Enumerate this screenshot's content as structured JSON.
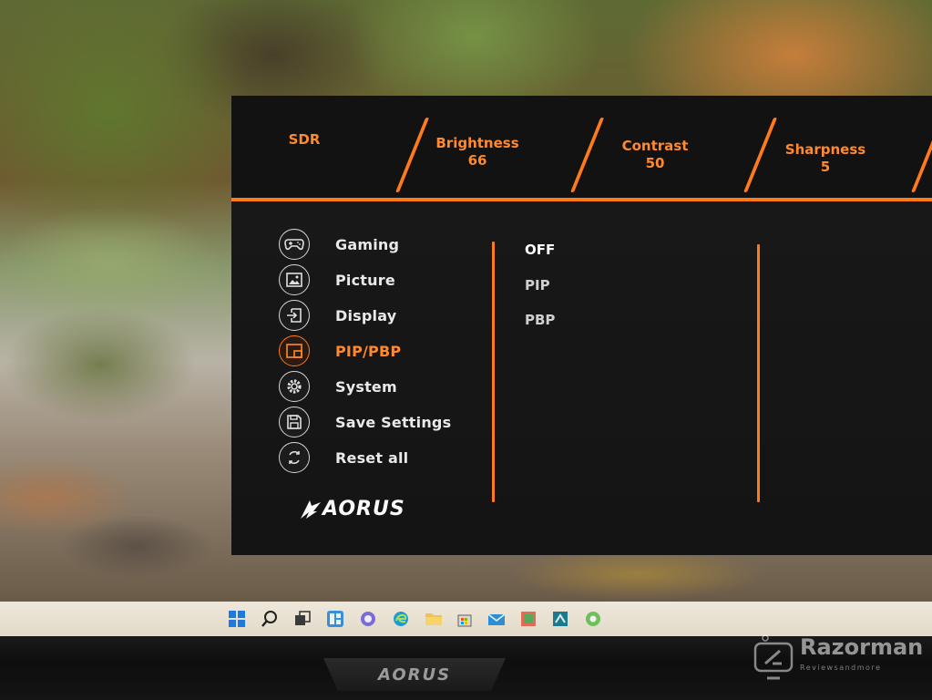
{
  "osd": {
    "top_bar": [
      {
        "label": "SDR",
        "value": ""
      },
      {
        "label": "Brightness",
        "value": "66"
      },
      {
        "label": "Contrast",
        "value": "50"
      },
      {
        "label": "Sharpness",
        "value": "5"
      }
    ],
    "menu": [
      {
        "label": "Gaming",
        "icon": "gamepad-icon",
        "active": false
      },
      {
        "label": "Picture",
        "icon": "picture-icon",
        "active": false
      },
      {
        "label": "Display",
        "icon": "input-icon",
        "active": false
      },
      {
        "label": "PIP/PBP",
        "icon": "pip-icon",
        "active": true
      },
      {
        "label": "System",
        "icon": "gear-icon",
        "active": false
      },
      {
        "label": "Save Settings",
        "icon": "floppy-disk-icon",
        "active": false
      },
      {
        "label": "Reset all",
        "icon": "reset-icon",
        "active": false
      }
    ],
    "options": [
      {
        "label": "OFF",
        "selected": true
      },
      {
        "label": "PIP",
        "selected": false
      },
      {
        "label": "PBP",
        "selected": false
      }
    ],
    "brand": "AORUS",
    "colors": {
      "accent": "#ff7a1a",
      "panel": "#141414",
      "text": "#e9e9e9"
    }
  },
  "taskbar": {
    "icons": [
      "windows-start-icon",
      "search-icon",
      "task-view-icon",
      "widgets-icon",
      "chat-icon",
      "edge-browser-icon",
      "file-explorer-icon",
      "store-icon",
      "mail-icon",
      "photos-icon",
      "app-icon",
      "chrome-icon"
    ]
  },
  "bezel": {
    "brand": "AORUS"
  },
  "watermark": {
    "name": "Razorman",
    "tagline": "Reviewsandmore"
  }
}
